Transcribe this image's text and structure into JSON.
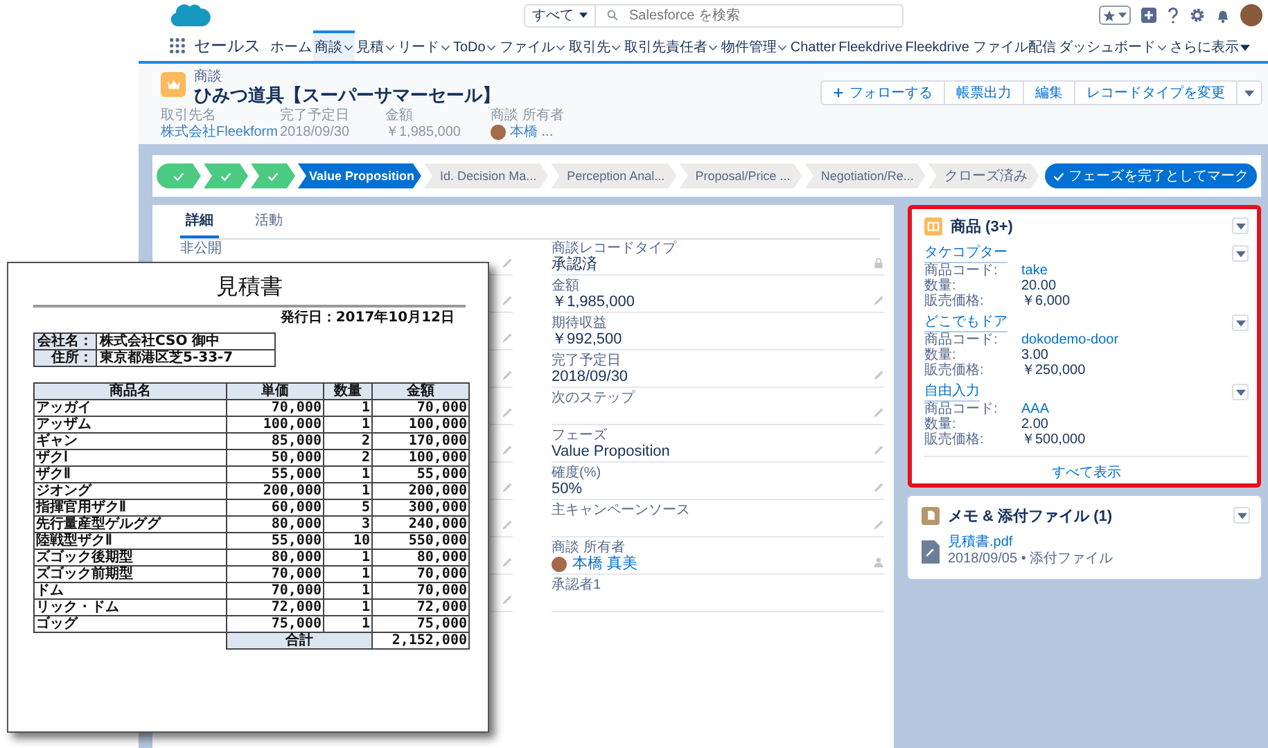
{
  "top_bar": {
    "scope": "すべて",
    "search_placeholder": "Salesforce を検索"
  },
  "app_name": "セールス",
  "nav_tabs": [
    {
      "label": "ホーム",
      "selected": false,
      "menu": false
    },
    {
      "label": "商談",
      "selected": true,
      "menu": true
    },
    {
      "label": "見積",
      "selected": false,
      "menu": true
    },
    {
      "label": "リード",
      "selected": false,
      "menu": true
    },
    {
      "label": "ToDo",
      "selected": false,
      "menu": true
    },
    {
      "label": "ファイル",
      "selected": false,
      "menu": true
    },
    {
      "label": "取引先",
      "selected": false,
      "menu": true
    },
    {
      "label": "取引先責任者",
      "selected": false,
      "menu": true
    },
    {
      "label": "物件管理",
      "selected": false,
      "menu": true
    },
    {
      "label": "Chatter",
      "selected": false,
      "menu": false
    },
    {
      "label": "Fleekdrive",
      "selected": false,
      "menu": false
    },
    {
      "label": "Fleekdrive ファイル配信",
      "selected": false,
      "menu": false
    },
    {
      "label": "ダッシュボード",
      "selected": false,
      "menu": true
    }
  ],
  "more_tabs": "さらに表示",
  "record": {
    "object": "商談",
    "title": "ひみつ道具【スーパーサマーセール】",
    "actions": [
      "フォローする",
      "帳票出力",
      "編集",
      "レコードタイプを変更"
    ],
    "highlights": [
      {
        "label": "取引先名",
        "value": "株式会社Fleekform",
        "kind": "link"
      },
      {
        "label": "完了予定日",
        "value": "2018/09/30",
        "kind": "text"
      },
      {
        "label": "金額",
        "value": "￥1,985,000",
        "kind": "text"
      },
      {
        "label": "商談 所有者",
        "value": "本橋 ...",
        "kind": "user"
      }
    ]
  },
  "path": {
    "steps": [
      {
        "done": true,
        "selected": false
      },
      {
        "done": true,
        "selected": false
      },
      {
        "done": true,
        "selected": false
      },
      {
        "label": "Value Proposition",
        "done": false,
        "selected": true
      },
      {
        "label": "Id. Decision Ma...",
        "done": false,
        "selected": false
      },
      {
        "label": "Perception Anal...",
        "done": false,
        "selected": false
      },
      {
        "label": "Proposal/Price ...",
        "done": false,
        "selected": false
      },
      {
        "label": "Negotiation/Re...",
        "done": false,
        "selected": false
      },
      {
        "label": "クローズ済み",
        "done": false,
        "selected": false
      }
    ],
    "button": "フェーズを完了としてマーク"
  },
  "detail_tabs": [
    {
      "label": "詳細",
      "selected": true
    },
    {
      "label": "活動",
      "selected": false
    }
  ],
  "left_fields": [
    {
      "label": "非公開"
    }
  ],
  "right_fields": [
    {
      "label": "商談レコードタイプ",
      "value": "承認済",
      "kind": "locked"
    },
    {
      "label": "金額",
      "value": "￥1,985,000",
      "kind": "text"
    },
    {
      "label": "期待収益",
      "value": "￥992,500",
      "kind": "plain"
    },
    {
      "label": "完了予定日",
      "value": "2018/09/30",
      "kind": "text"
    },
    {
      "label": "次のステップ",
      "kind": "text"
    },
    {
      "label": "フェーズ",
      "value": "Value Proposition",
      "kind": "text"
    },
    {
      "label": "確度(%)",
      "value": "50%",
      "kind": "text"
    },
    {
      "label": "主キャンペーンソース",
      "kind": "text"
    },
    {
      "label": "商談 所有者",
      "value": "本橋 真美",
      "kind": "user"
    },
    {
      "label": "承認者1",
      "kind": "plain"
    }
  ],
  "products": {
    "title": "商品 (3+)",
    "highlighted": true,
    "items": [
      {
        "name": "タケコプター",
        "fields": [
          {
            "label": "商品コード:",
            "value": "take",
            "kind": "link"
          },
          {
            "label": "数量:",
            "value": "20.00",
            "kind": "text"
          },
          {
            "label": "販売価格:",
            "value": "￥6,000",
            "kind": "text"
          }
        ]
      },
      {
        "name": "どこでもドア",
        "fields": [
          {
            "label": "商品コード:",
            "value": "dokodemo-door",
            "kind": "link"
          },
          {
            "label": "数量:",
            "value": "3.00",
            "kind": "text"
          },
          {
            "label": "販売価格:",
            "value": "￥250,000",
            "kind": "text"
          }
        ]
      },
      {
        "name": "自由入力",
        "fields": [
          {
            "label": "商品コード:",
            "value": "AAA",
            "kind": "link"
          },
          {
            "label": "数量:",
            "value": "2.00",
            "kind": "text"
          },
          {
            "label": "販売価格:",
            "value": "￥500,000",
            "kind": "text"
          }
        ]
      }
    ],
    "view_all": "すべて表示"
  },
  "notes": {
    "title": "メモ & 添付ファイル (1)",
    "files": [
      {
        "name": "見積書.pdf",
        "meta": "2018/09/05 • 添付ファイル"
      }
    ]
  },
  "quote_document": {
    "title": "見積書",
    "issue_date": "発行日：2017年10月12日",
    "info": [
      {
        "label": "会社名：",
        "value": "株式会社CSO 御中"
      },
      {
        "label": "住所：",
        "value": "東京都港区芝5-33-7"
      }
    ],
    "columns": [
      "商品名",
      "単価",
      "数量",
      "金額"
    ],
    "rows": [
      [
        "アッガイ",
        "70,000",
        "1",
        "70,000"
      ],
      [
        "アッザム",
        "100,000",
        "1",
        "100,000"
      ],
      [
        "ギャン",
        "85,000",
        "2",
        "170,000"
      ],
      [
        "ザクⅠ",
        "50,000",
        "2",
        "100,000"
      ],
      [
        "ザクⅡ",
        "55,000",
        "1",
        "55,000"
      ],
      [
        "ジオング",
        "200,000",
        "1",
        "200,000"
      ],
      [
        "指揮官用ザクⅡ",
        "60,000",
        "5",
        "300,000"
      ],
      [
        "先行量産型ゲルググ",
        "80,000",
        "3",
        "240,000"
      ],
      [
        "陸戦型ザクⅡ",
        "55,000",
        "10",
        "550,000"
      ],
      [
        "ズゴック後期型",
        "80,000",
        "1",
        "80,000"
      ],
      [
        "ズゴック前期型",
        "70,000",
        "1",
        "70,000"
      ],
      [
        "ドム",
        "70,000",
        "1",
        "70,000"
      ],
      [
        "リック・ドム",
        "72,000",
        "1",
        "72,000"
      ],
      [
        "ゴッグ",
        "75,000",
        "1",
        "75,000"
      ]
    ],
    "total_label": "合計",
    "total": "2,152,000"
  }
}
